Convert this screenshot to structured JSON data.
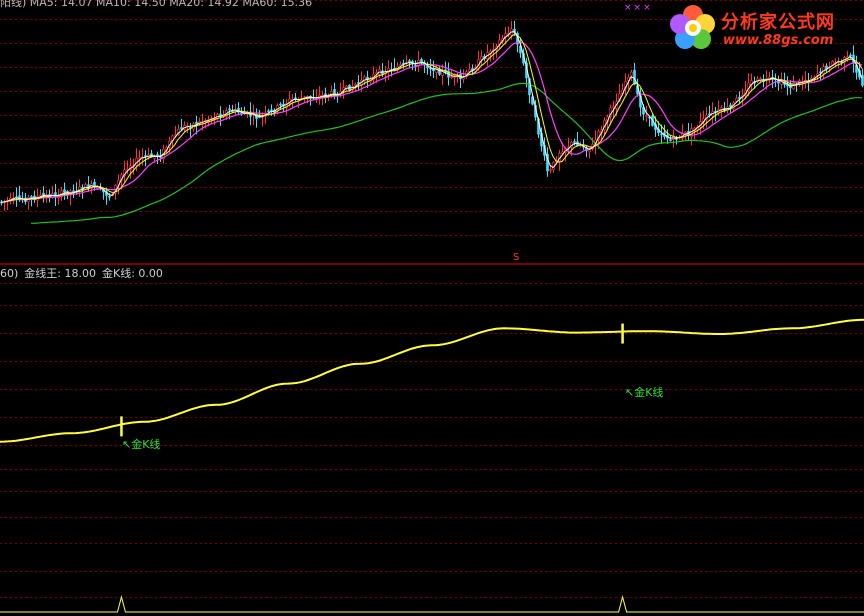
{
  "main_panel": {
    "header_fragment": "阳线) MA5: 14.07  MA10: 14.50  MA20: 14.92  MA60: 15.36",
    "x_markers": "×××",
    "s_marker": "S"
  },
  "indicator_panel": {
    "header_prefix": "60)",
    "line1_name": "金线王",
    "line1_value": "18.00",
    "line2_name": "金K线",
    "line2_value": "0.00",
    "signal_label_1": "↖金K线",
    "signal_label_2": "↖金K线"
  },
  "logo": {
    "title": "分析家公式网",
    "url": "www.88gs.com"
  },
  "colors": {
    "background": "#000000",
    "grid": "#800000",
    "divider": "#c00000",
    "ma5": "#ffffff",
    "ma10": "#ffff00",
    "ma20": "#ff40ff",
    "ma60": "#20c020",
    "up_candle": "#ff3030",
    "down_candle": "#40e0ff",
    "gold_line": "#ffff40",
    "signal_label": "#2ee02e"
  },
  "chart_data": {
    "type": "line",
    "series": [
      {
        "name": "金线王",
        "values": [
          10.0,
          10.6,
          11.4,
          12.6,
          14.1,
          15.5,
          16.8,
          18.0,
          17.7,
          17.8,
          17.6,
          18.0,
          18.6
        ]
      }
    ],
    "signals": [
      {
        "label": "金K线",
        "position": 0.14
      },
      {
        "label": "金K线",
        "position": 0.72
      }
    ]
  }
}
